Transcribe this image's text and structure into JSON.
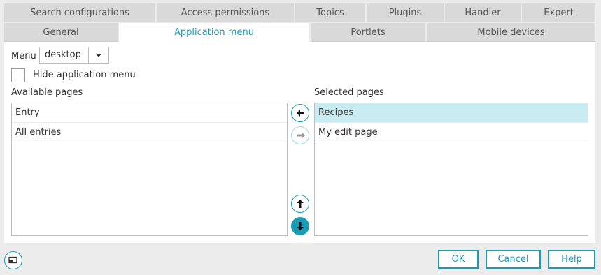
{
  "tabs_row1": [
    {
      "label": "Search configurations"
    },
    {
      "label": "Access permissions"
    },
    {
      "label": "Topics"
    },
    {
      "label": "Plugins"
    },
    {
      "label": "Handler"
    },
    {
      "label": "Expert"
    }
  ],
  "tabs_row2": [
    {
      "label": "General"
    },
    {
      "label": "Application menu",
      "active": true
    },
    {
      "label": "Portlets"
    },
    {
      "label": "Mobile devices"
    }
  ],
  "menu": {
    "label": "Menu",
    "value": "desktop"
  },
  "hide_menu": {
    "label": "Hide application menu",
    "checked": false
  },
  "available": {
    "label": "Available pages",
    "items": [
      "Entry",
      "All entries"
    ]
  },
  "selected": {
    "label": "Selected pages",
    "items": [
      "Recipes",
      "My edit page"
    ],
    "selected_index": 0
  },
  "icons": {
    "move_left": "arrow-left-icon",
    "move_right": "arrow-right-icon",
    "move_up": "arrow-up-icon",
    "move_down": "arrow-down-icon",
    "window": "window-icon"
  },
  "footer": {
    "ok": "OK",
    "cancel": "Cancel",
    "help": "Help"
  },
  "colors": {
    "accent": "#1a9cb5",
    "selected_row": "#c9ebf2",
    "tab_bg": "#d9d9d9",
    "page_bg": "#ececec"
  }
}
